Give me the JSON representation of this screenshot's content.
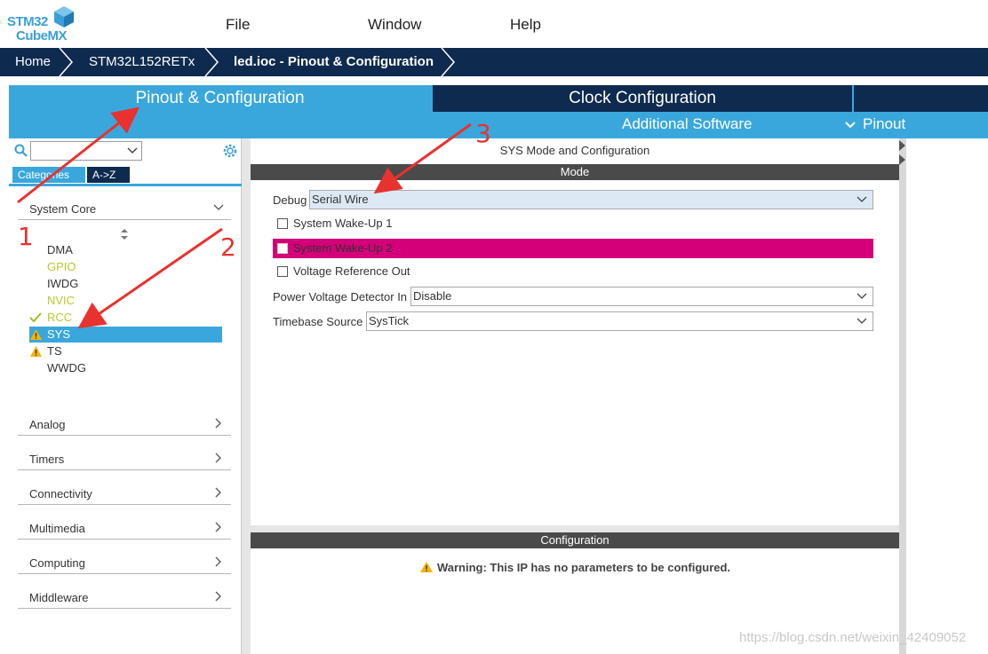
{
  "logo": {
    "line1": "STM32",
    "line2": "CubeMX"
  },
  "menu": {
    "file": "File",
    "window": "Window",
    "help": "Help"
  },
  "breadcrumb": {
    "home": "Home",
    "device": "STM32L152RETx",
    "project": "led.ioc - Pinout & Configuration"
  },
  "tabs": {
    "pinout": "Pinout & Configuration",
    "clock": "Clock Configuration"
  },
  "subtabs": {
    "additional": "Additional Software",
    "pinout": "Pinout"
  },
  "left": {
    "category_tabs": [
      "Categories",
      "A->Z"
    ],
    "system_core": "System Core",
    "items": [
      "DMA",
      "GPIO",
      "IWDG",
      "NVIC",
      "RCC",
      "SYS",
      "TS",
      "WWDG"
    ],
    "groups": [
      "Analog",
      "Timers",
      "Connectivity",
      "Multimedia",
      "Computing",
      "Middleware"
    ]
  },
  "main": {
    "title": "SYS Mode and Configuration",
    "mode_header": "Mode",
    "debug_label": "Debug",
    "debug_value": "Serial Wire",
    "wakeup1": "System Wake-Up 1",
    "wakeup2": "System Wake-Up 2",
    "vref": "Voltage Reference Out",
    "pvd_label": "Power Voltage Detector In",
    "pvd_value": "Disable",
    "timebase_label": "Timebase Source",
    "timebase_value": "SysTick",
    "config_header": "Configuration",
    "warning": "Warning: This IP has no parameters to be configured."
  },
  "annotations": [
    "1",
    "2",
    "3"
  ],
  "watermark": "https://blog.csdn.net/weixin_42409052",
  "colors": {
    "accent": "#3aa7dc",
    "dark": "#0e2a4f",
    "highlight": "#d4007a",
    "ok": "#9bbf2a",
    "warn": "#f2b600"
  }
}
